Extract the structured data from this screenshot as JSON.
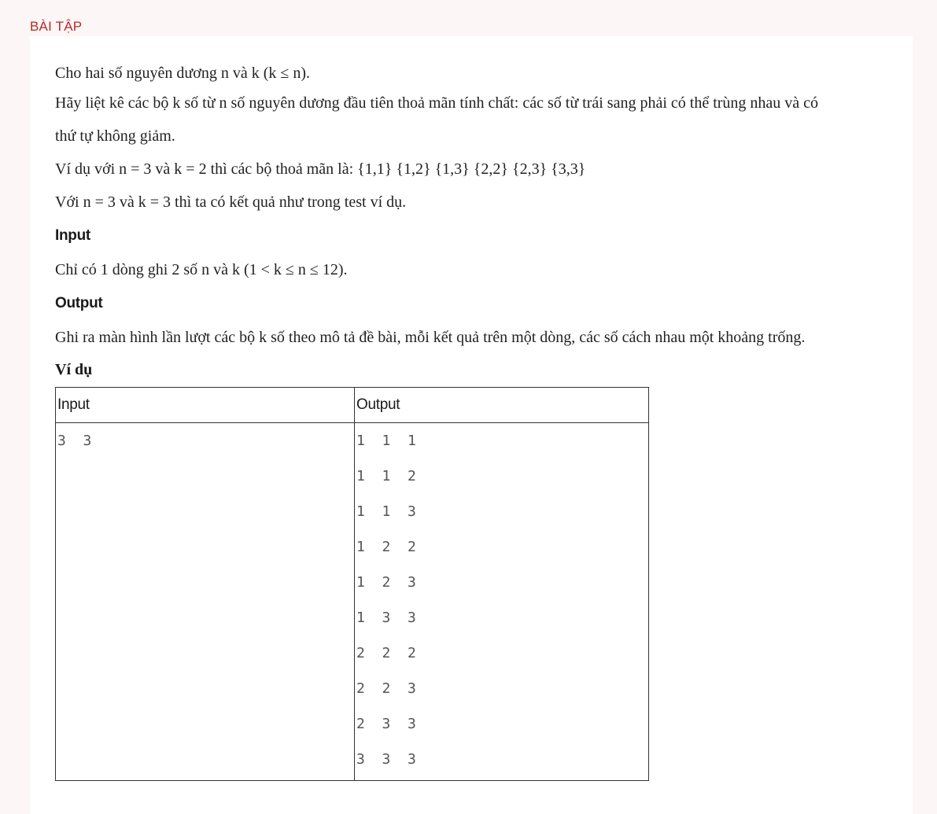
{
  "section_title": "BÀI TẬP",
  "problem": {
    "intro": "Cho hai số nguyên dương n và k (k ≤ n).",
    "task_line1": "Hãy liệt kê các bộ k số từ n số nguyên dương đầu tiên thoả mãn tính chất: các số từ trái sang phải có thể trùng nhau và có",
    "task_line2": "thứ tự không giảm.",
    "example_text": "Ví dụ với n = 3 và k = 2 thì các bộ thoả mãn là: {1,1} {1,2} {1,3} {2,2} {2,3} {3,3}",
    "example_note": "Với n = 3 và k = 3 thì ta có kết quả như trong test ví dụ.",
    "input_heading": "Input",
    "input_text": "Chỉ có 1 dòng ghi 2 số n và k (1 < k ≤ n ≤ 12).",
    "output_heading": "Output",
    "output_text": "Ghi ra màn hình lần lượt các bộ k số theo mô tả đề bài, mỗi kết quả trên một dòng, các số cách nhau một khoảng trống.",
    "example_heading": "Ví dụ"
  },
  "example_table": {
    "headers": [
      "Input",
      "Output"
    ],
    "input_lines": [
      "3 3"
    ],
    "output_lines": [
      "1 1 1",
      "1 1 2",
      "1 1 3",
      "1 2 2",
      "1 2 3",
      "1 3 3",
      "2 2 2",
      "2 2 3",
      "2 3 3",
      "3 3 3"
    ]
  }
}
